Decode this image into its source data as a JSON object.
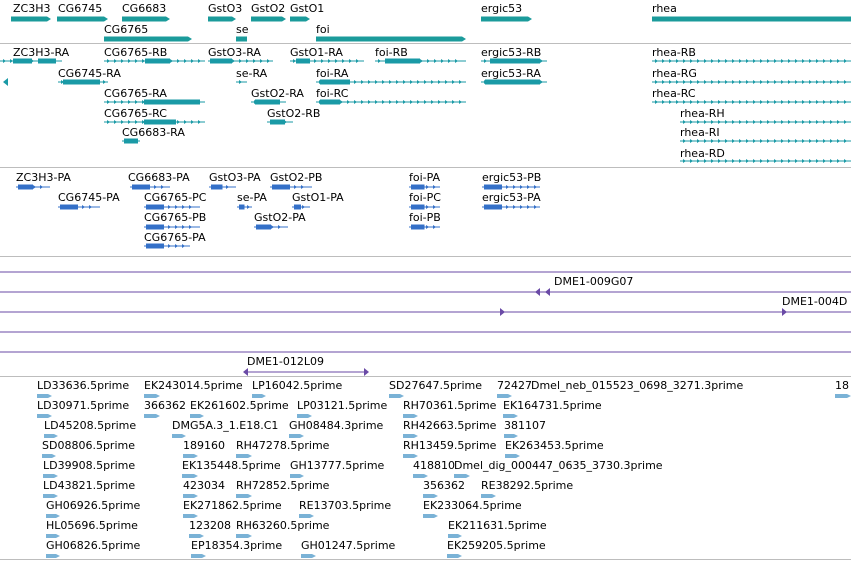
{
  "colors": {
    "gene": "#1b9b9b",
    "transcript": "#1a9aa6",
    "protein": "#3470c8",
    "clone": "#6a4aa6",
    "est": "#7ab2d6",
    "separator": "#bdbdbd"
  },
  "tracks": {
    "genes": [
      {
        "label": "ZC3H3"
      },
      {
        "label": "CG6745"
      },
      {
        "label": "CG6683"
      },
      {
        "label": "GstO3"
      },
      {
        "label": "GstO2"
      },
      {
        "label": "GstO1"
      },
      {
        "label": "ergic53"
      },
      {
        "label": "rhea"
      },
      {
        "label": "CG6765"
      },
      {
        "label": "se"
      },
      {
        "label": "foi"
      }
    ],
    "transcripts": [
      {
        "label": "ZC3H3-RA"
      },
      {
        "label": "CG6765-RB"
      },
      {
        "label": "GstO3-RA"
      },
      {
        "label": "GstO1-RA"
      },
      {
        "label": "foi-RB"
      },
      {
        "label": "ergic53-RB"
      },
      {
        "label": "rhea-RB"
      },
      {
        "label": "CG6745-RA"
      },
      {
        "label": "se-RA"
      },
      {
        "label": "foi-RA"
      },
      {
        "label": "ergic53-RA"
      },
      {
        "label": "rhea-RG"
      },
      {
        "label": "CG6765-RA"
      },
      {
        "label": "GstO2-RA"
      },
      {
        "label": "foi-RC"
      },
      {
        "label": "rhea-RC"
      },
      {
        "label": "CG6765-RC"
      },
      {
        "label": "GstO2-RB"
      },
      {
        "label": "rhea-RH"
      },
      {
        "label": "CG6683-RA"
      },
      {
        "label": "rhea-RI"
      },
      {
        "label": "rhea-RD"
      }
    ],
    "proteins": [
      {
        "label": "ZC3H3-PA"
      },
      {
        "label": "CG6683-PA"
      },
      {
        "label": "GstO3-PA"
      },
      {
        "label": "GstO2-PB"
      },
      {
        "label": "foi-PA"
      },
      {
        "label": "ergic53-PB"
      },
      {
        "label": "CG6745-PA"
      },
      {
        "label": "CG6765-PC"
      },
      {
        "label": "se-PA"
      },
      {
        "label": "GstO1-PA"
      },
      {
        "label": "foi-PC"
      },
      {
        "label": "ergic53-PA"
      },
      {
        "label": "CG6765-PB"
      },
      {
        "label": "GstO2-PA"
      },
      {
        "label": "foi-PB"
      },
      {
        "label": "CG6765-PA"
      }
    ],
    "clones": [
      {
        "label": "DME1-009G07"
      },
      {
        "label": "DME1-004D"
      },
      {
        "label": "DME1-012L09"
      }
    ],
    "ests": [
      {
        "label": "LD33636.5prime"
      },
      {
        "label": "EK243014.5prime"
      },
      {
        "label": "LP16042.5prime"
      },
      {
        "label": "SD27647.5prime"
      },
      {
        "label": "72427"
      },
      {
        "label": "Dmel_neb_015523_0698_3271.3prime"
      },
      {
        "label": "18"
      },
      {
        "label": "LD30971.5prime"
      },
      {
        "label": "366362"
      },
      {
        "label": "EK261602.5prime"
      },
      {
        "label": "LP03121.5prime"
      },
      {
        "label": "RH70361.5prime"
      },
      {
        "label": "EK164731.5prime"
      },
      {
        "label": "LD45208.5prime"
      },
      {
        "label": "DMG5A.3_1.E18.C1"
      },
      {
        "label": "GH08484.3prime"
      },
      {
        "label": "RH42663.5prime"
      },
      {
        "label": "381107"
      },
      {
        "label": "SD08806.5prime"
      },
      {
        "label": "189160"
      },
      {
        "label": "RH47278.5prime"
      },
      {
        "label": "RH13459.5prime"
      },
      {
        "label": "EK263453.5prime"
      },
      {
        "label": "LD39908.5prime"
      },
      {
        "label": "EK135448.5prime"
      },
      {
        "label": "GH13777.5prime"
      },
      {
        "label": "418810"
      },
      {
        "label": "Dmel_dig_000447_0635_3730.3prime"
      },
      {
        "label": "LD43821.5prime"
      },
      {
        "label": "423034"
      },
      {
        "label": "RH72852.5prime"
      },
      {
        "label": "356362"
      },
      {
        "label": "RE38292.5prime"
      },
      {
        "label": "GH06926.5prime"
      },
      {
        "label": "EK271862.5prime"
      },
      {
        "label": "RE13703.5prime"
      },
      {
        "label": "EK233064.5prime"
      },
      {
        "label": "HL05696.5prime"
      },
      {
        "label": "123208"
      },
      {
        "label": "RH63260.5prime"
      },
      {
        "label": "EK211631.5prime"
      },
      {
        "label": "GH06826.5prime"
      },
      {
        "label": "EP18354.3prime"
      },
      {
        "label": "GH01247.5prime"
      },
      {
        "label": "EK259205.5prime"
      }
    ]
  }
}
